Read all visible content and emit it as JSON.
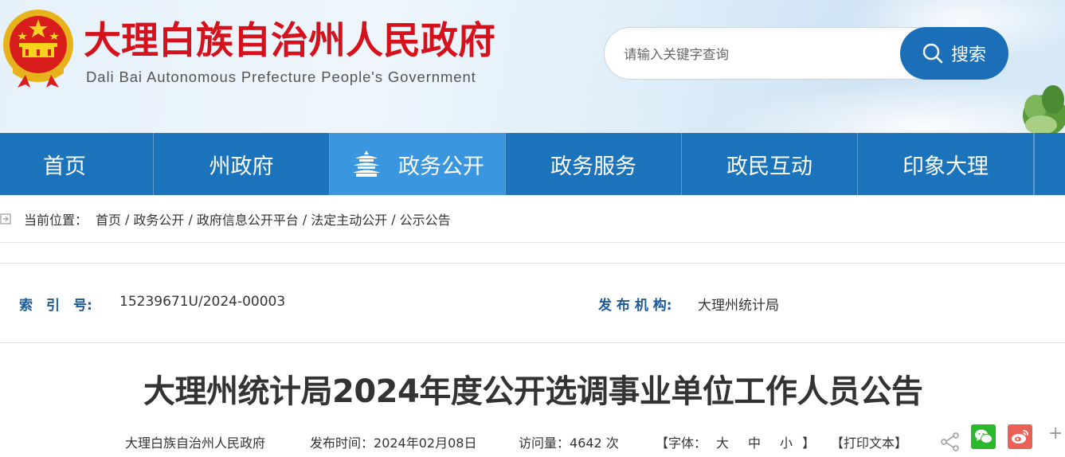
{
  "header": {
    "title": "大理白族自治州人民政府",
    "subtitle": "Dali Bai Autonomous Prefecture People's Government",
    "search": {
      "placeholder": "请输入关键字查询",
      "button_label": "搜索"
    }
  },
  "nav": {
    "items": [
      {
        "label": "首页",
        "active": false
      },
      {
        "label": "州政府",
        "active": false
      },
      {
        "label": "政务公开",
        "active": true
      },
      {
        "label": "政务服务",
        "active": false
      },
      {
        "label": "政民互动",
        "active": false
      },
      {
        "label": "印象大理",
        "active": false
      }
    ]
  },
  "breadcrumb": {
    "prefix": "当前位置：",
    "separator": "/",
    "items": [
      "首页",
      "政务公开",
      "政府信息公开平台",
      "法定主动公开",
      "公示公告"
    ]
  },
  "meta": {
    "index_label": "索　引　号:",
    "index_value": "15239671U/2024-00003",
    "publisher_label": "发 布 机 构:",
    "publisher_value": "大理州统计局"
  },
  "article": {
    "title": "大理州统计局2024年度公开选调事业单位工作人员公告",
    "source": "大理白族自治州人民政府",
    "date_label": "发布时间：",
    "date_value": "2024年02月08日",
    "views_label": "访问量：",
    "views_value": "4642",
    "views_unit": "次",
    "font_label": "【字体：",
    "font_large": "大",
    "font_medium": "中",
    "font_small": "小",
    "font_close": "】",
    "print_label": "【打印文本】"
  },
  "colors": {
    "brand_red": "#d5121b",
    "nav_blue": "#1b74bb",
    "nav_active": "#3a97df",
    "meta_label": "#1c5a9a"
  },
  "icons": [
    "national-emblem",
    "search-icon",
    "pavilion-icon",
    "home-icon",
    "share-icon",
    "wechat-icon",
    "weibo-icon",
    "plus-icon"
  ]
}
